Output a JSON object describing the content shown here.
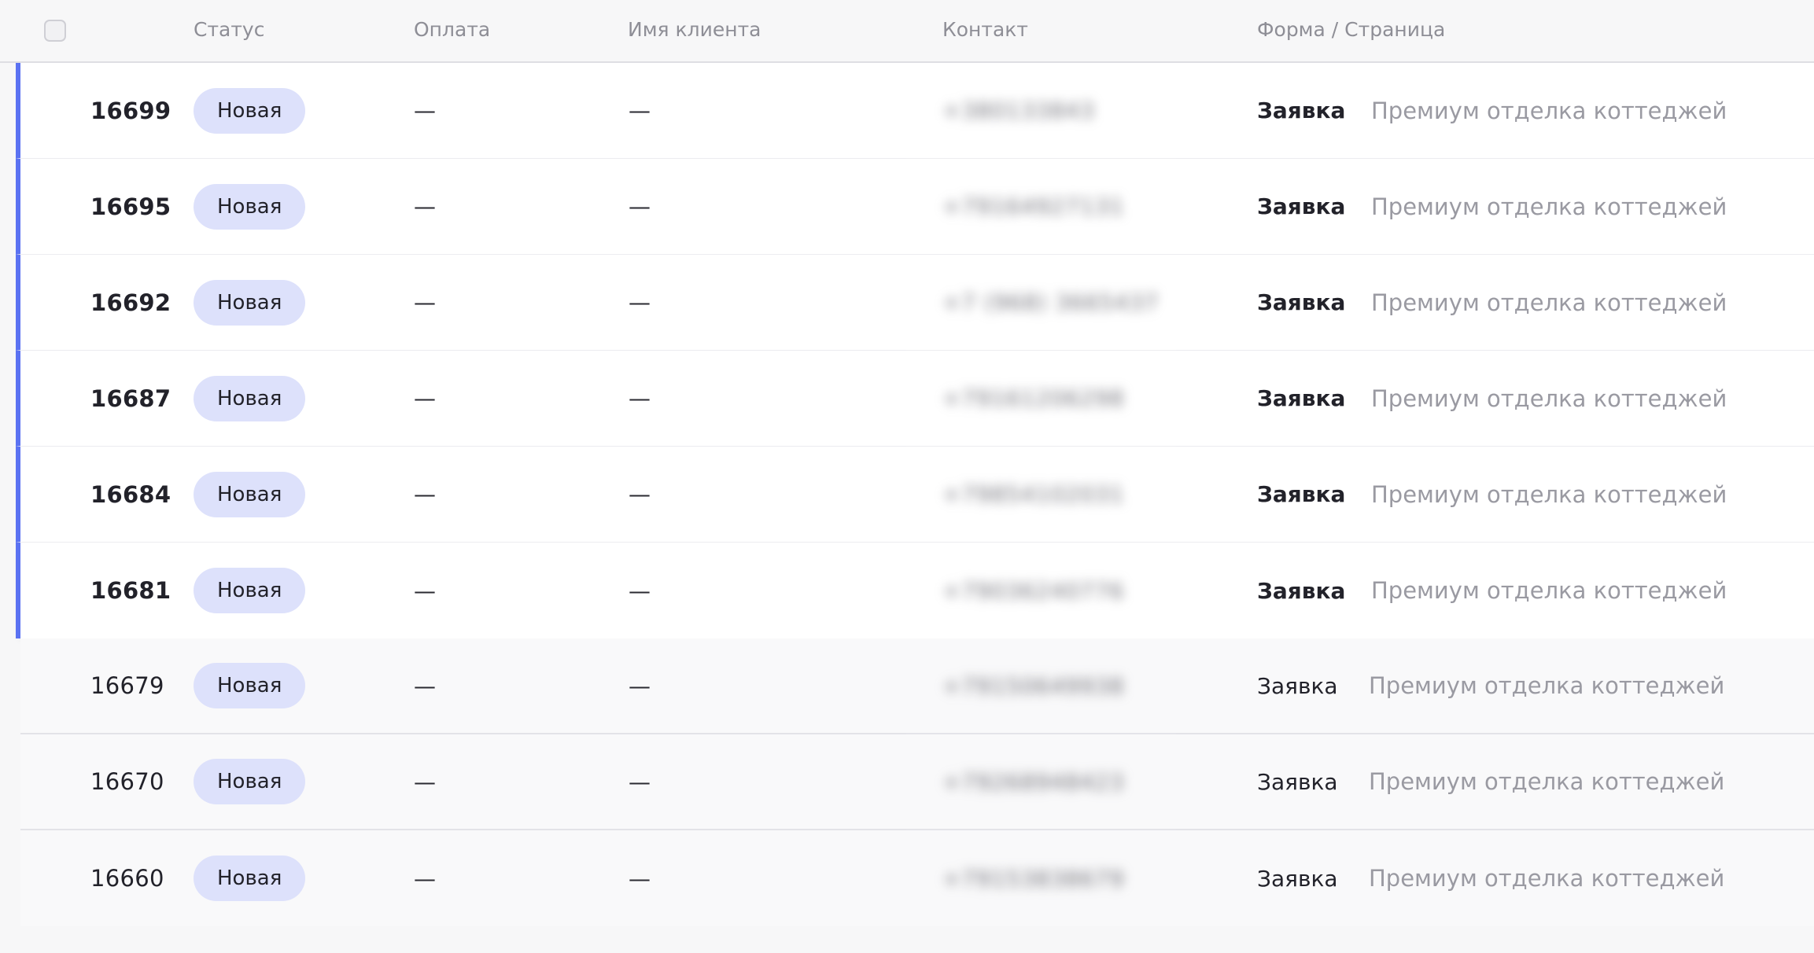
{
  "header": {
    "status": "Статус",
    "payment": "Оплата",
    "client_name": "Имя клиента",
    "contact": "Контакт",
    "form_page": "Форма / Страница"
  },
  "colors": {
    "accent": "#5b72f2",
    "badge_bg": "#dde1fb"
  },
  "rows": [
    {
      "id": "16699",
      "status": "Новая",
      "payment": "—",
      "name": "—",
      "contact": "+380133843",
      "form": "Заявка",
      "page": "Премиум отделка коттеджей",
      "unread": true
    },
    {
      "id": "16695",
      "status": "Новая",
      "payment": "—",
      "name": "—",
      "contact": "+79164927131",
      "form": "Заявка",
      "page": "Премиум отделка коттеджей",
      "unread": true
    },
    {
      "id": "16692",
      "status": "Новая",
      "payment": "—",
      "name": "—",
      "contact": "+7 (968) 3665437",
      "form": "Заявка",
      "page": "Премиум отделка коттеджей",
      "unread": true
    },
    {
      "id": "16687",
      "status": "Новая",
      "payment": "—",
      "name": "—",
      "contact": "+79161206298",
      "form": "Заявка",
      "page": "Премиум отделка коттеджей",
      "unread": true
    },
    {
      "id": "16684",
      "status": "Новая",
      "payment": "—",
      "name": "—",
      "contact": "+79854102031",
      "form": "Заявка",
      "page": "Премиум отделка коттеджей",
      "unread": true
    },
    {
      "id": "16681",
      "status": "Новая",
      "payment": "—",
      "name": "—",
      "contact": "+79036240776",
      "form": "Заявка",
      "page": "Премиум отделка коттеджей",
      "unread": true
    },
    {
      "id": "16679",
      "status": "Новая",
      "payment": "—",
      "name": "—",
      "contact": "+79150649938",
      "form": "Заявка",
      "page": "Премиум отделка коттеджей",
      "unread": false
    },
    {
      "id": "16670",
      "status": "Новая",
      "payment": "—",
      "name": "—",
      "contact": "+79268948423",
      "form": "Заявка",
      "page": "Премиум отделка коттеджей",
      "unread": false
    },
    {
      "id": "16660",
      "status": "Новая",
      "payment": "—",
      "name": "—",
      "contact": "+79153838679",
      "form": "Заявка",
      "page": "Премиум отделка коттеджей",
      "unread": false
    }
  ]
}
